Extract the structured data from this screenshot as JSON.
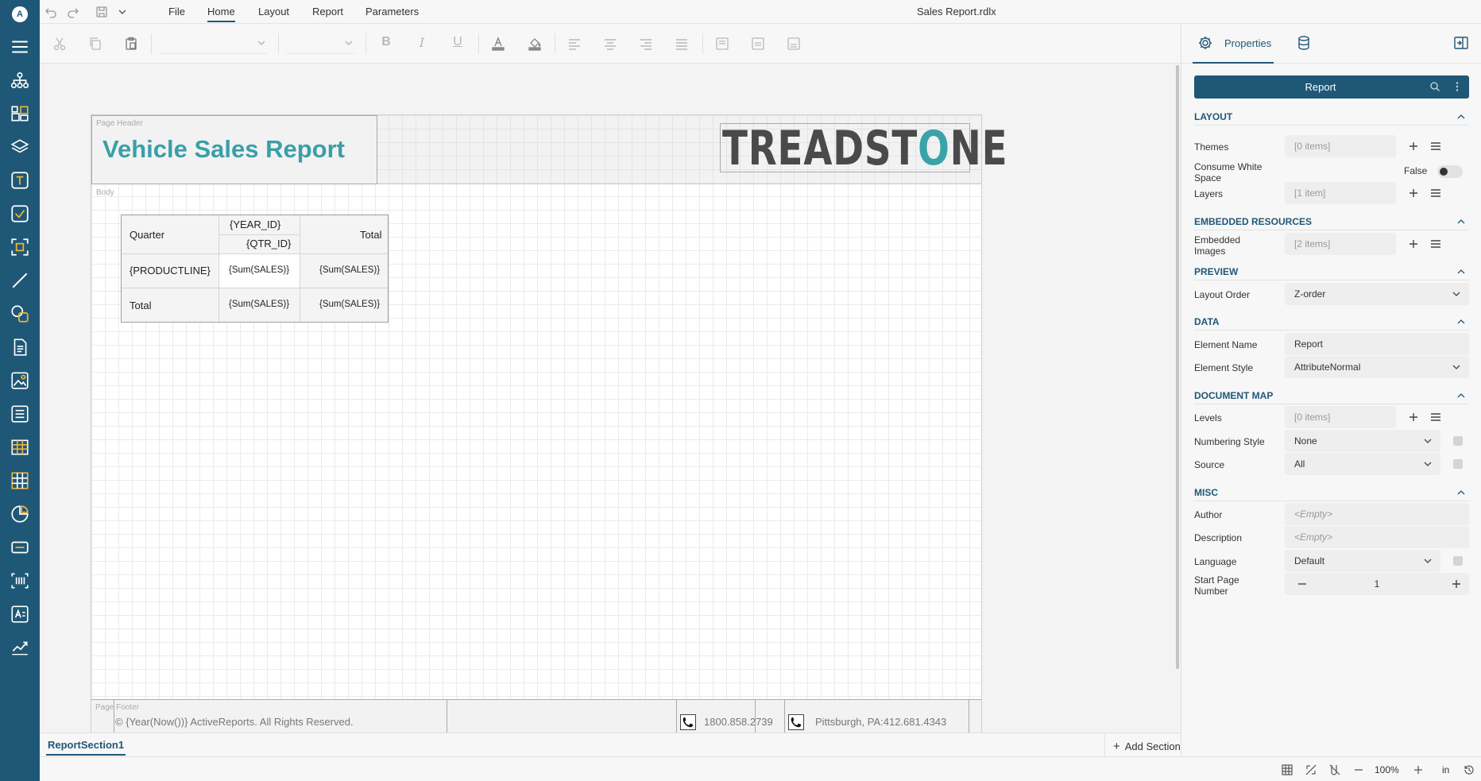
{
  "app": {
    "document_title": "Sales Report.rdlx",
    "logo_letter": "A"
  },
  "menu": {
    "tabs": [
      {
        "label": "File"
      },
      {
        "label": "Home",
        "active": true
      },
      {
        "label": "Layout"
      },
      {
        "label": "Report"
      },
      {
        "label": "Parameters"
      }
    ]
  },
  "toolbar": {
    "letters": {
      "bold": "B",
      "italic": "I",
      "underline": "U"
    }
  },
  "report": {
    "page_header_label": "Page Header",
    "title": "Vehicle Sales Report",
    "logo_text_start": "TREADST",
    "logo_text_o": "O",
    "logo_text_end": "NE",
    "body_label": "Body",
    "page_footer_label": "Page Footer",
    "matrix": {
      "corner": "Quarter",
      "col_group1": "{YEAR_ID}",
      "col_group2": "{QTR_ID}",
      "total_col": "Total",
      "row_group": "{PRODUCTLINE}",
      "row_value": "{Sum(SALES)}",
      "row_total": "{Sum(SALES)}",
      "total_row_label": "Total",
      "total_value": "{Sum(SALES)}",
      "grand_total": "{Sum(SALES)}"
    },
    "footer": {
      "copyright": "© {Year(Now())} ActiveReports. All Rights Reserved.",
      "phone1": "1800.858.2739",
      "phone2": "Pittsburgh, PA:412.681.4343"
    }
  },
  "sections": {
    "tab": "ReportSection1",
    "add_label": "Add Section"
  },
  "status": {
    "zoom": "100%",
    "units": "in"
  },
  "panel": {
    "tab_properties": "Properties",
    "object": "Report",
    "groups": {
      "layout": "LAYOUT",
      "embedded": "EMBEDDED RESOURCES",
      "preview": "PREVIEW",
      "data": "DATA",
      "docmap": "DOCUMENT MAP",
      "misc": "MISC"
    },
    "props": {
      "themes_label": "Themes",
      "themes_value": "[0 items]",
      "cws_label": "Consume White Space",
      "cws_value": "False",
      "layers_label": "Layers",
      "layers_value": "[1 item]",
      "images_label": "Embedded Images",
      "images_value": "[2 items]",
      "layout_order_label": "Layout Order",
      "layout_order_value": "Z-order",
      "element_name_label": "Element Name",
      "element_name_value": "Report",
      "element_style_label": "Element Style",
      "element_style_value": "AttributeNormal",
      "levels_label": "Levels",
      "levels_value": "[0 items]",
      "numbering_label": "Numbering Style",
      "numbering_value": "None",
      "source_label": "Source",
      "source_value": "All",
      "author_label": "Author",
      "author_placeholder": "<Empty>",
      "description_label": "Description",
      "description_placeholder": "<Empty>",
      "language_label": "Language",
      "language_value": "Default",
      "start_page_label": "Start Page Number",
      "start_page_value": "1"
    }
  },
  "colors": {
    "rail": "#1f5877",
    "accent": "#f3b23a",
    "title_teal": "#3a9fa8"
  },
  "icons": [
    "menu-icon",
    "hierarchy-icon",
    "components-icon",
    "layers-icon",
    "textbox-icon",
    "checkbox-icon",
    "container-icon",
    "line-icon",
    "shapes-icon",
    "richtext-icon",
    "image-icon",
    "list-icon",
    "table-icon",
    "tablix-icon",
    "chart-icon",
    "subreport-icon",
    "barcode-icon",
    "formatted-text-icon",
    "sparkline-icon"
  ]
}
